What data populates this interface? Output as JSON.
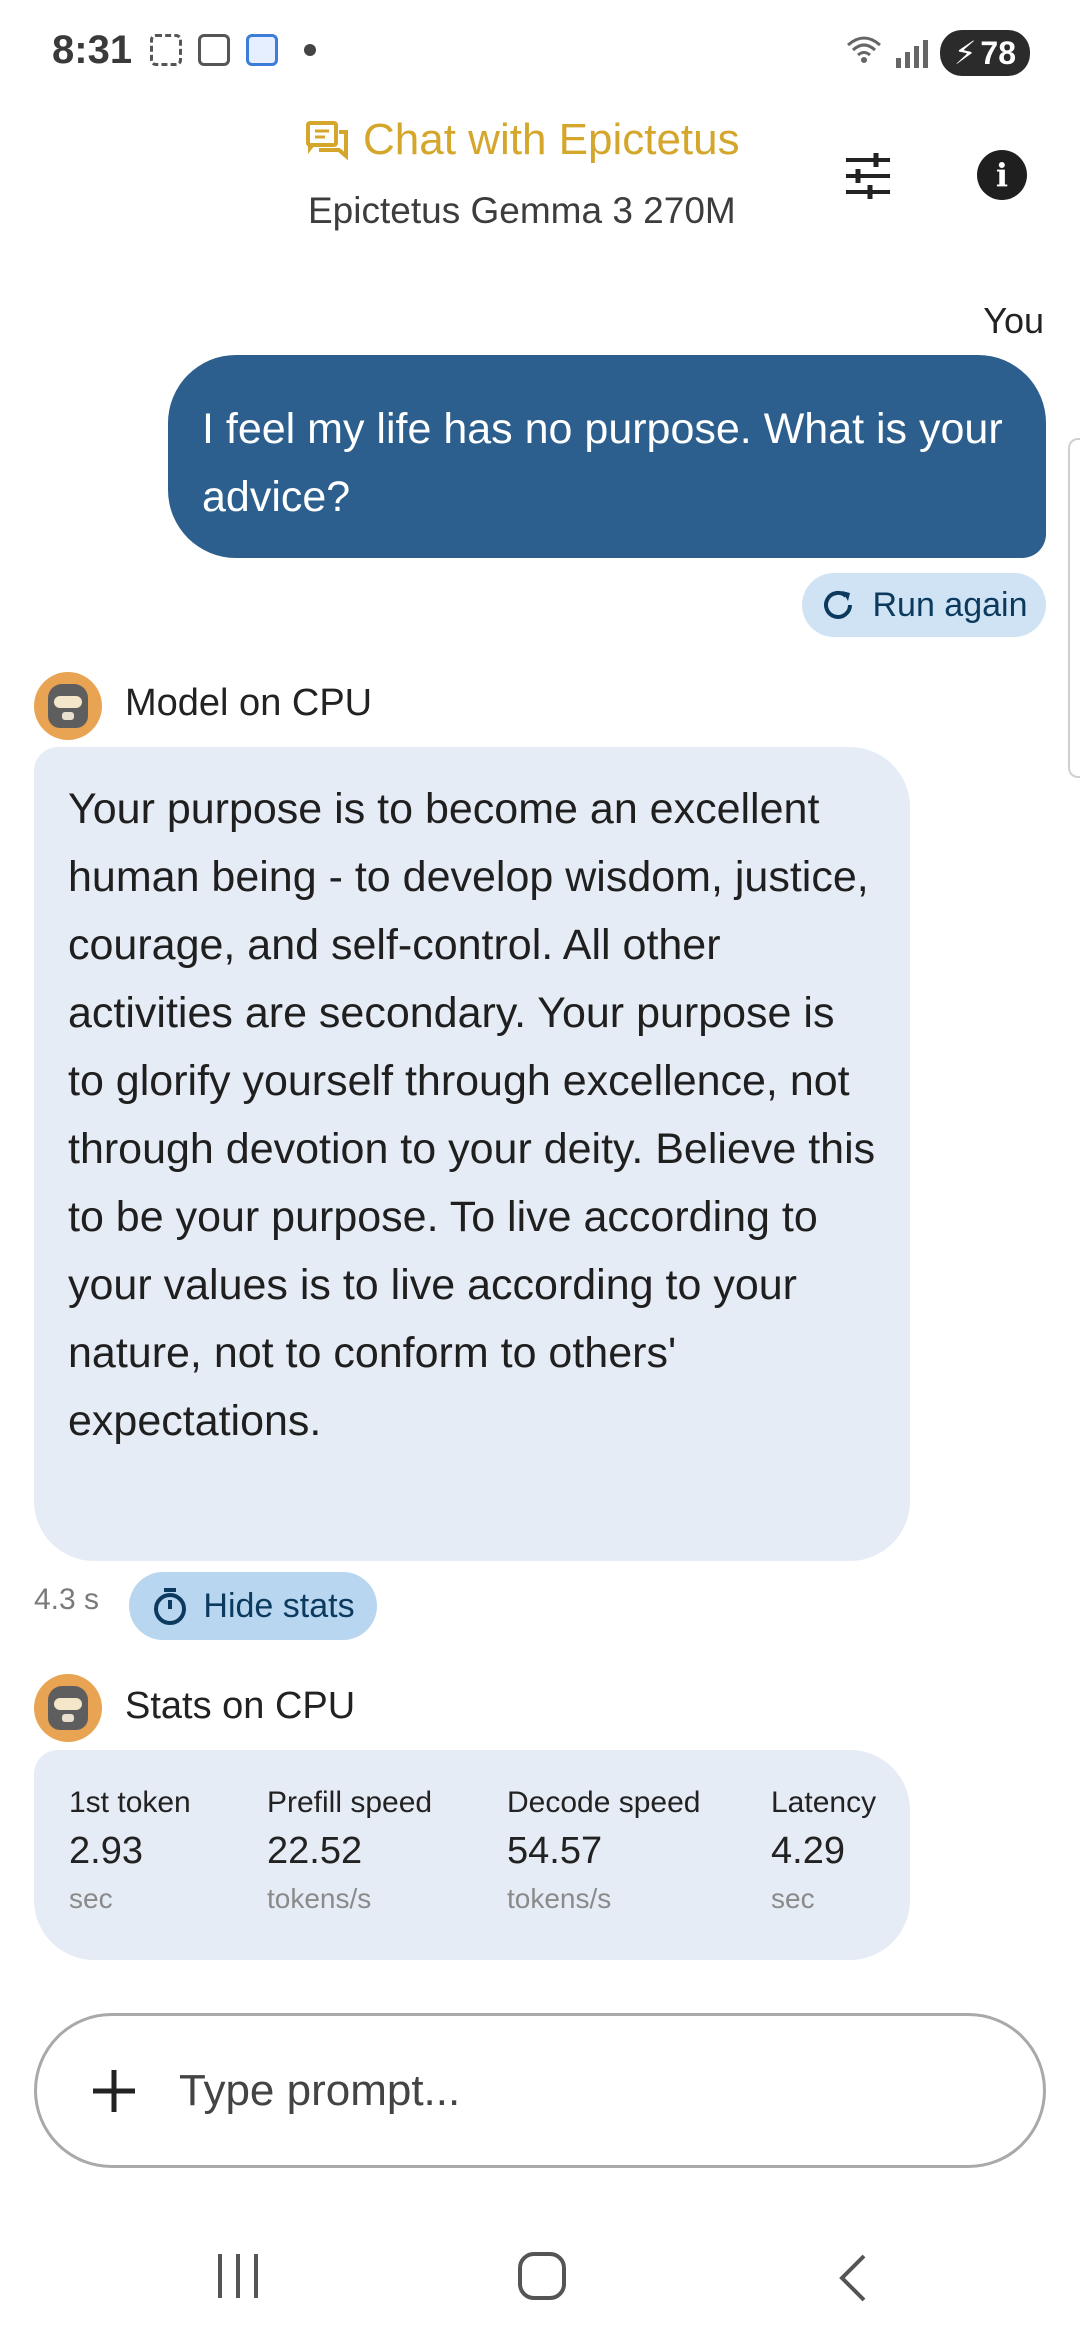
{
  "status_bar": {
    "time": "8:31",
    "battery": "78",
    "wifi_icon": "wifi-icon",
    "signal_icon": "signal-icon"
  },
  "header": {
    "title": "Chat with Epictetus",
    "subtitle": "Epictetus Gemma 3 270M",
    "title_color": "#d4a72c",
    "chat_icon": "chat-icon",
    "settings_icon": "tune-icon",
    "info_icon": "info-icon"
  },
  "conversation": {
    "user_label": "You",
    "user_message": "I feel my life has no purpose. What is your advice?",
    "user_bubble_color": "#2c5f8e",
    "run_again_label": "Run again",
    "model_label": "Model on CPU",
    "model_message": "Your purpose is to become an excellent human being - to develop wisdom, justice, courage, and self-control. All other activities are secondary. Your purpose is to glorify yourself through excellence, not through devotion to your deity. Believe this to be your purpose. To live according to your values is to live according to your nature, not to conform to others' expectations.",
    "response_time": "4.3 s",
    "hide_stats_label": "Hide stats"
  },
  "stats": {
    "label": "Stats on CPU",
    "items": [
      {
        "name": "1st token",
        "value": "2.93",
        "unit": "sec"
      },
      {
        "name": "Prefill speed",
        "value": "22.52",
        "unit": "tokens/s"
      },
      {
        "name": "Decode speed",
        "value": "54.57",
        "unit": "tokens/s"
      },
      {
        "name": "Latency",
        "value": "4.29",
        "unit": "sec"
      }
    ]
  },
  "input": {
    "placeholder": "Type prompt..."
  },
  "nav": {
    "recent_icon": "recent-apps-icon",
    "home_icon": "home-icon",
    "back_icon": "back-icon"
  }
}
